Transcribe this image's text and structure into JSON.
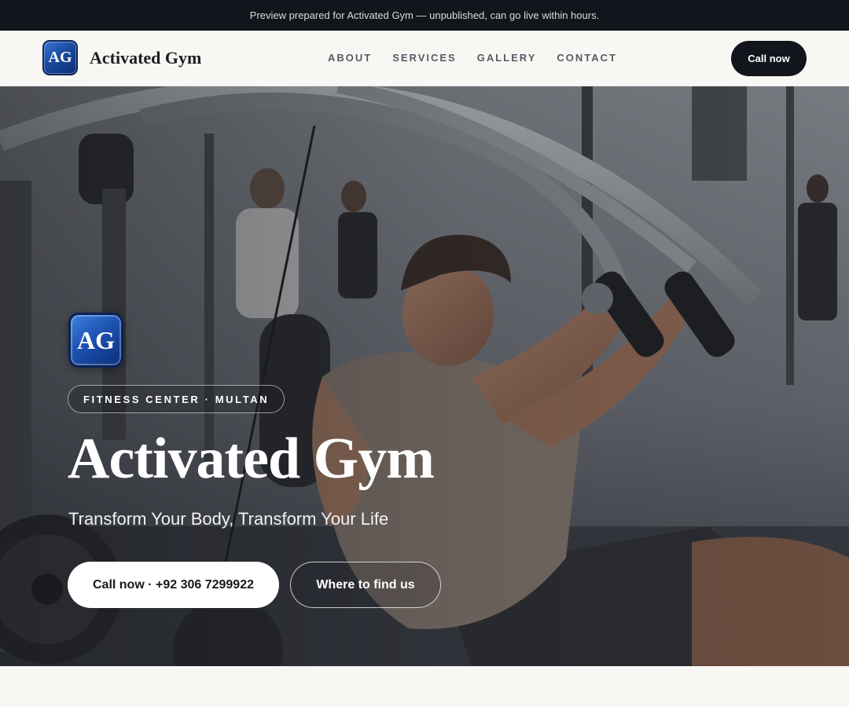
{
  "banner": {
    "text": "Preview prepared for Activated Gym — unpublished, can go live within hours."
  },
  "header": {
    "logo_initials": "AG",
    "brand_name": "Activated Gym",
    "nav": [
      {
        "label": "ABOUT"
      },
      {
        "label": "SERVICES"
      },
      {
        "label": "GALLERY"
      },
      {
        "label": "CONTACT"
      }
    ],
    "cta_label": "Call now"
  },
  "hero": {
    "logo_initials": "AG",
    "tag": "FITNESS CENTER · MULTAN",
    "title": "Activated Gym",
    "subtitle": "Transform Your Body, Transform Your Life",
    "primary_button": "Call now · +92 306 7299922",
    "secondary_button": "Where to find us",
    "background_image": "man-using-gym-machine-photo"
  },
  "colors": {
    "dark": "#12151b",
    "page_bg": "#f8f7f3",
    "logo_blue": "#1d52b0"
  }
}
